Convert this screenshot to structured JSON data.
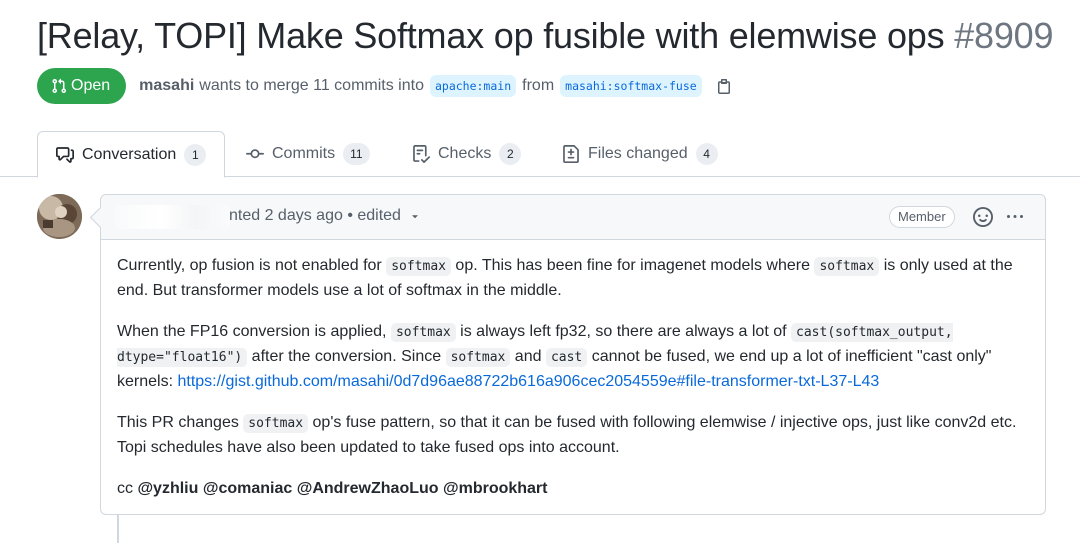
{
  "pr": {
    "title": "[Relay, TOPI] Make Softmax op fusible with elemwise ops",
    "number": "#8909",
    "state": "Open",
    "author": "masahi",
    "merge_text": "wants to merge 11 commits into",
    "base_branch": "apache:main",
    "from_text": "from",
    "head_branch": "masahi:softmax-fuse"
  },
  "tabs": [
    {
      "label": "Conversation",
      "count": "1",
      "icon": "comment-discussion-icon"
    },
    {
      "label": "Commits",
      "count": "11",
      "icon": "git-commit-icon"
    },
    {
      "label": "Checks",
      "count": "2",
      "icon": "checklist-icon"
    },
    {
      "label": "Files changed",
      "count": "4",
      "icon": "file-diff-icon"
    }
  ],
  "comment": {
    "header_text": "nted 2 days ago • edited",
    "role_badge": "Member",
    "p1": {
      "t1": "Currently, op fusion is not enabled for ",
      "c1": "softmax",
      "t2": " op. This has been fine for imagenet models where ",
      "c2": "softmax",
      "t3": " is only used at the end. But transformer models use a lot of softmax in the middle."
    },
    "p2": {
      "t1": "When the FP16 conversion is applied, ",
      "c1": "softmax",
      "t2": " is always left fp32, so there are always a lot of ",
      "c2": "cast(softmax_output, dtype=\"float16\")",
      "t3": " after the conversion. Since ",
      "c3": "softmax",
      "t4": " and ",
      "c4": "cast",
      "t5": " cannot be fused, we end up a lot of inefficient \"cast only\" kernels: ",
      "link": "https://gist.github.com/masahi/0d7d96ae88722b616a906cec2054559e#file-transformer-txt-L37-L43"
    },
    "p3": {
      "t1": "This PR changes ",
      "c1": "softmax",
      "t2": " op's fuse pattern, so that it can be fused with following elemwise / injective ops, just like conv2d etc. Topi schedules have also been updated to take fused ops into account."
    },
    "cc": {
      "prefix": "cc",
      "mentions": [
        "@yzhliu",
        "@comaniac",
        "@AndrewZhaoLuo",
        "@mbrookhart"
      ]
    }
  },
  "colors": {
    "open_green": "#2da44e",
    "link_blue": "#0969da",
    "branch_bg": "#ddf4ff"
  }
}
